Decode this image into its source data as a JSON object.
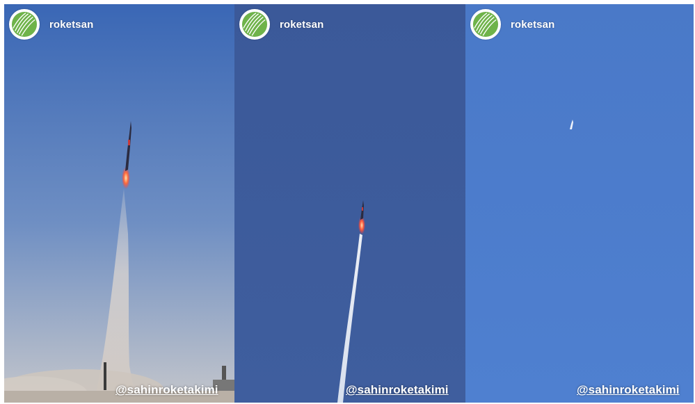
{
  "stories": [
    {
      "username": "roketsan",
      "mention": "@sahinroketakimi"
    },
    {
      "username": "roketsan",
      "mention": "@sahinroketakimi"
    },
    {
      "username": "roketsan",
      "mention": "@sahinroketakimi"
    }
  ],
  "colors": {
    "sky_top_1": "#3e6bb8",
    "sky_bottom_1": "#b5bfd0",
    "sky_2": "#3c5a95",
    "sky_3": "#4c7ccc",
    "logo_green": "#6fb34a",
    "flame": "#ff5a3a"
  },
  "icons": {
    "avatar": "roketsan-logo-icon"
  }
}
